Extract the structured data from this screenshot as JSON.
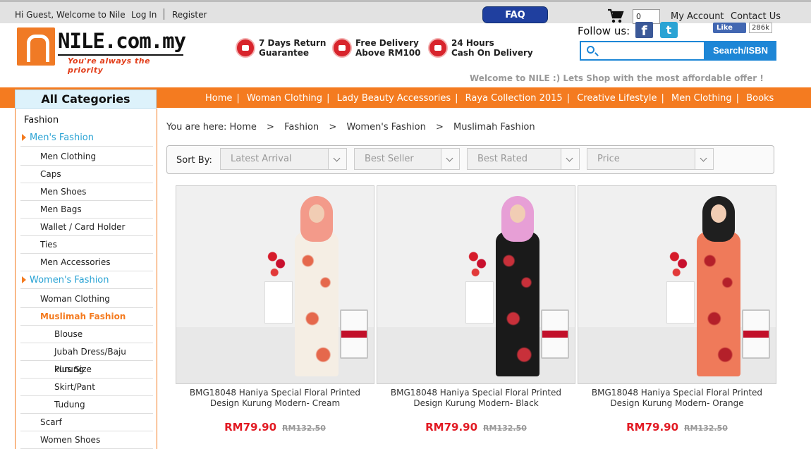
{
  "topbar": {
    "greeting": "Hi Guest, Welcome to Nile",
    "login": "Log In",
    "register": "Register",
    "faq": "FAQ",
    "cart_count": "0",
    "my_account": "My Account",
    "contact_us": "Contact Us"
  },
  "logo": {
    "name": "NILE.com.my",
    "tagline": "You're always the priority"
  },
  "features": [
    {
      "line1": "7 Days Return",
      "line2": "Guarantee",
      "icon": "return-hand-icon"
    },
    {
      "line1": "Free Delivery",
      "line2": "Above RM100",
      "icon": "delivery-truck-icon"
    },
    {
      "line1": "24 Hours",
      "line2": "Cash On Delivery",
      "icon": "lightning-icon"
    }
  ],
  "social": {
    "follow_label": "Follow us:",
    "facebook_letter": "f",
    "twitter_letter": "t",
    "like_label": "Like",
    "like_count": "286k"
  },
  "search": {
    "placeholder": "",
    "button_label": "Search/ISBN"
  },
  "welcome_message": "Welcome to NILE :) Lets Shop with the most affordable offer !",
  "nav": [
    "Home",
    "Woman Clothing",
    "Lady Beauty Accessories",
    "Raya Collection 2015",
    "Creative Lifestyle",
    "Men Clothing",
    "Books"
  ],
  "sidebar": {
    "title": "All Categories",
    "heading": "Fashion",
    "items": [
      {
        "label": "Men's Fashion",
        "type": "cat"
      },
      {
        "label": "Men Clothing",
        "type": "sub"
      },
      {
        "label": "Caps",
        "type": "sub"
      },
      {
        "label": "Men Shoes",
        "type": "sub"
      },
      {
        "label": "Men Bags",
        "type": "sub"
      },
      {
        "label": "Wallet / Card Holder",
        "type": "sub"
      },
      {
        "label": "Ties",
        "type": "sub"
      },
      {
        "label": "Men Accessories",
        "type": "sub"
      },
      {
        "label": "Women's Fashion",
        "type": "cat"
      },
      {
        "label": "Woman Clothing",
        "type": "sub"
      },
      {
        "label": "Muslimah Fashion",
        "type": "active"
      },
      {
        "label": "Blouse",
        "type": "subsub"
      },
      {
        "label": "Jubah Dress/Baju kurung",
        "type": "subsub"
      },
      {
        "label": "Plus Size",
        "type": "subsub"
      },
      {
        "label": "Skirt/Pant",
        "type": "subsub"
      },
      {
        "label": "Tudung",
        "type": "subsub"
      },
      {
        "label": "Scarf",
        "type": "sub"
      },
      {
        "label": "Women Shoes",
        "type": "sub"
      }
    ]
  },
  "breadcrumb": {
    "prefix": "You are here:",
    "items": [
      "Home",
      "Fashion",
      "Women's Fashion",
      "Muslimah Fashion"
    ],
    "separator": ">"
  },
  "sort": {
    "label": "Sort By:",
    "options": [
      "Latest Arrival",
      "Best Seller",
      "Best Rated",
      "Price"
    ]
  },
  "products": [
    {
      "title_line1": "BMG18048 Haniya Special Floral Printed",
      "title_line2": "Design Kurung Modern- Cream",
      "price": "RM79.90",
      "old_price": "RM132.50",
      "hijab_color": "#f39a8a",
      "dress_color": "#f5eee4",
      "print_color": "#e5684c"
    },
    {
      "title_line1": "BMG18048 Haniya Special Floral Printed",
      "title_line2": "Design Kurung Modern- Black",
      "price": "RM79.90",
      "old_price": "RM132.50",
      "hijab_color": "#e79fd6",
      "dress_color": "#1a1a1a",
      "print_color": "#c8303a"
    },
    {
      "title_line1": "BMG18048 Haniya Special Floral Printed",
      "title_line2": "Design Kurung Modern- Orange",
      "price": "RM79.90",
      "old_price": "RM132.50",
      "hijab_color": "#1f1f1f",
      "dress_color": "#ef7a5a",
      "print_color": "#b4202a"
    }
  ],
  "colors": {
    "brand_orange": "#f47b20",
    "faq_blue": "#1f3f9f",
    "search_blue": "#1d86d6",
    "price_red": "#e21a23",
    "category_blue": "#2aa3d4"
  }
}
